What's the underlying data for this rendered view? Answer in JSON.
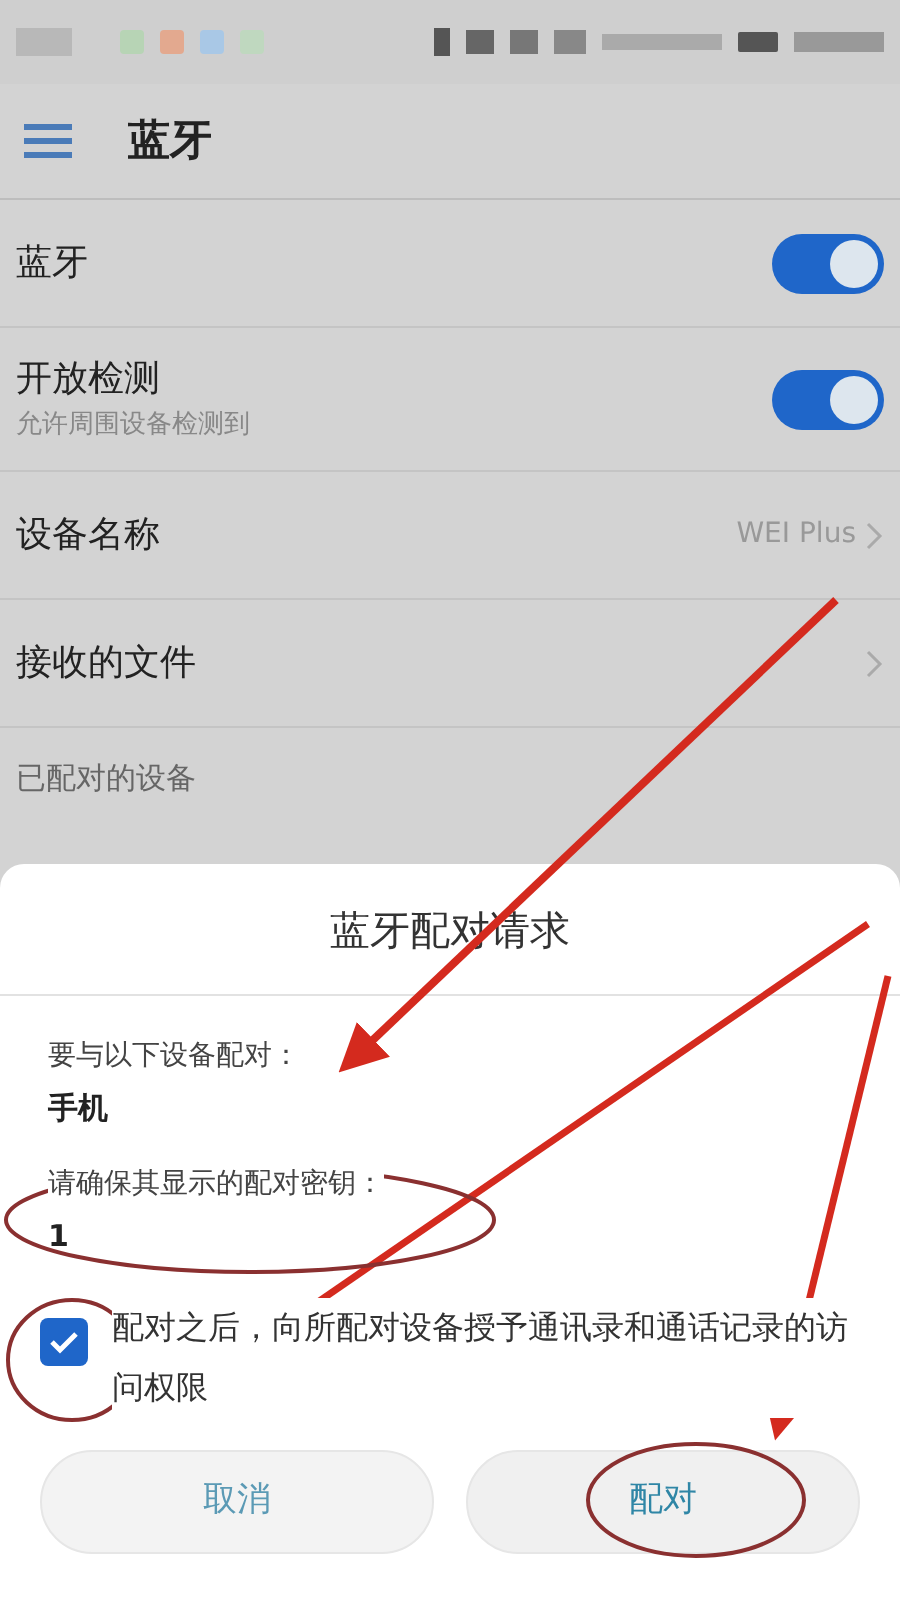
{
  "header": {
    "title": "蓝牙"
  },
  "settings": [
    {
      "kind": "toggle",
      "label": "蓝牙",
      "on": true
    },
    {
      "kind": "toggle",
      "label": "开放检测",
      "subtitle": "允许周围设备检测到",
      "on": true
    },
    {
      "kind": "link",
      "label": "设备名称",
      "value": "WEI Plus"
    },
    {
      "kind": "link",
      "label": "接收的文件"
    }
  ],
  "section_header": "已配对的设备",
  "dialog": {
    "title": "蓝牙配对请求",
    "prompt": "要与以下设备配对：",
    "device": "手机",
    "key_prompt": "请确保其显示的配对密钥：",
    "key": "1",
    "share_contacts": {
      "label": "配对之后，向所配对设备授予通讯录和通话记录的访问权限",
      "checked": true
    },
    "buttons": [
      {
        "label": "取消",
        "kind": "cancel"
      },
      {
        "label": "配对",
        "kind": "confirm"
      }
    ]
  }
}
